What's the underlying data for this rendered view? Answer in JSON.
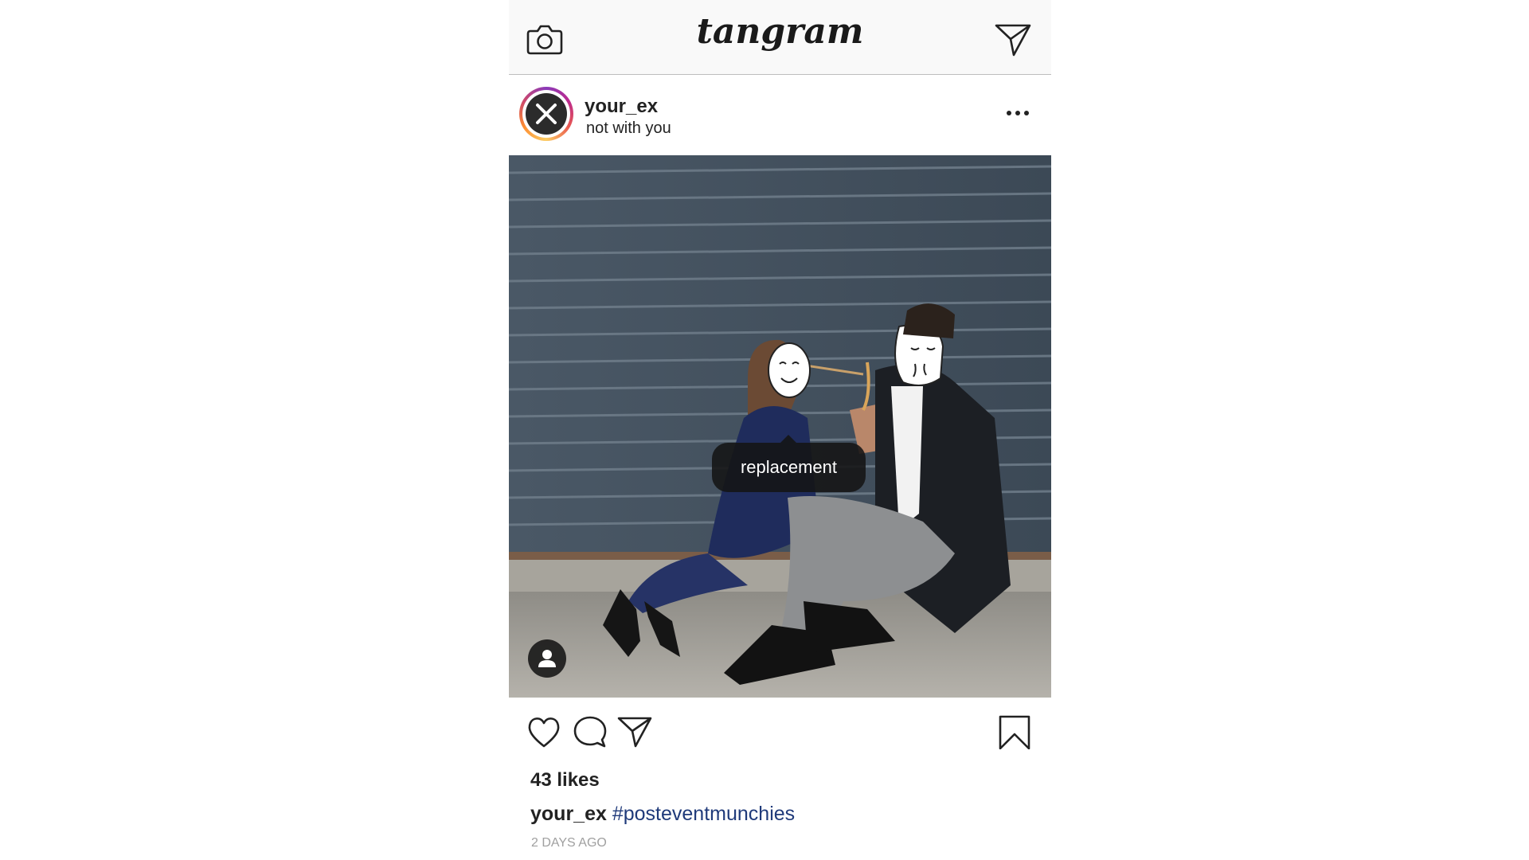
{
  "app": {
    "name": "tangram"
  },
  "topbar": {
    "left_icon": "camera-icon",
    "right_icon": "paper-plane-icon"
  },
  "post": {
    "username": "your_ex",
    "location": "not with you",
    "more_icon": "more-dots-icon",
    "photo": {
      "tag_label": "replacement",
      "user_tag_icon": "person-icon"
    },
    "actions": {
      "like_icon": "heart-icon",
      "comment_icon": "comment-bubble-icon",
      "share_icon": "paper-plane-icon",
      "save_icon": "bookmark-icon"
    },
    "likes": "43 likes",
    "caption": {
      "username": "your_ex",
      "hashtag": "#posteventmunchies"
    },
    "timestamp": "2 DAYS AGO"
  },
  "colors": {
    "hashtag": "#1f3a7a",
    "timestamp": "#a0a0a0",
    "topbar_bg": "#f9f9f9",
    "ring": "#bc2a8d"
  }
}
